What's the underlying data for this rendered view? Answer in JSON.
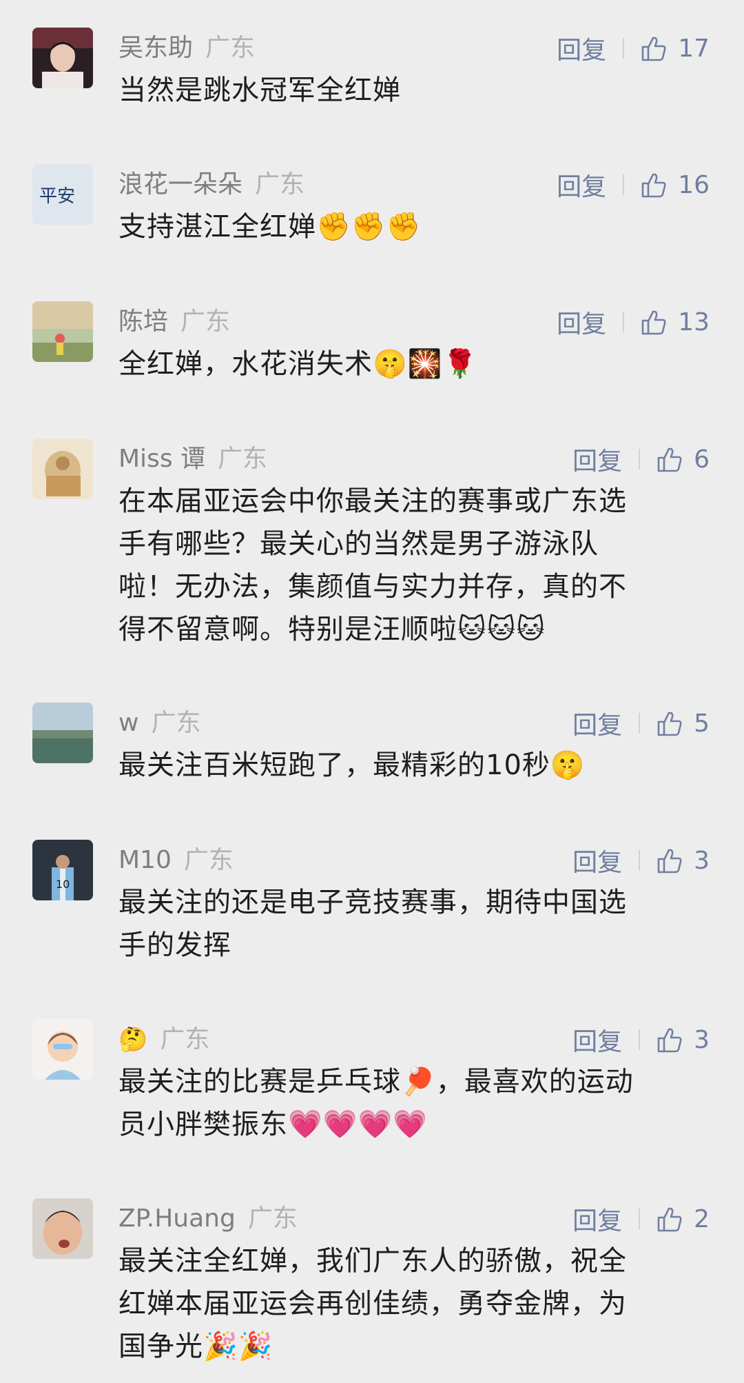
{
  "comments": [
    {
      "name": "吴东助",
      "location": "广东",
      "reply": "回复",
      "likes": "17",
      "lines": [
        "当然是跳水冠军全红婵"
      ]
    },
    {
      "name": "浪花一朵朵",
      "location": "广东",
      "reply": "回复",
      "likes": "16",
      "lines": [
        "支持湛江全红婵✊✊✊"
      ]
    },
    {
      "name": "陈培",
      "location": "广东",
      "reply": "回复",
      "likes": "13",
      "lines": [
        "全红婵，水花消失术🤫🎇🌹"
      ]
    },
    {
      "name": "Miss 谭",
      "location": "广东",
      "reply": "回复",
      "likes": "6",
      "lines": [
        "在本届亚运会中你最关注的赛事或广东选",
        "手有哪些？最关心的当然是男子游泳队",
        "啦！无办法，集颜值与实力并存，真的不",
        "得不留意啊。特别是汪顺啦🐱🐱🐱"
      ]
    },
    {
      "name": "w",
      "location": "广东",
      "reply": "回复",
      "likes": "5",
      "lines": [
        "最关注百米短跑了，最精彩的10秒🤫"
      ]
    },
    {
      "name": "M10",
      "location": "广东",
      "reply": "回复",
      "likes": "3",
      "lines": [
        "最关注的还是电子竞技赛事，期待中国选",
        "手的发挥"
      ]
    },
    {
      "name": "🤔",
      "location": "广东",
      "reply": "回复",
      "likes": "3",
      "lines": [
        "最关注的比赛是乒乓球🏓，最喜欢的运动",
        "员小胖樊振东💗💗💗💗"
      ]
    },
    {
      "name": "ZP.Huang",
      "location": "广东",
      "reply": "回复",
      "likes": "2",
      "lines": [
        "最关注全红婵，我们广东人的骄傲，祝全",
        "红婵本届亚运会再创佳绩，勇夺金牌，为",
        "国争光🎉🎉"
      ]
    }
  ]
}
